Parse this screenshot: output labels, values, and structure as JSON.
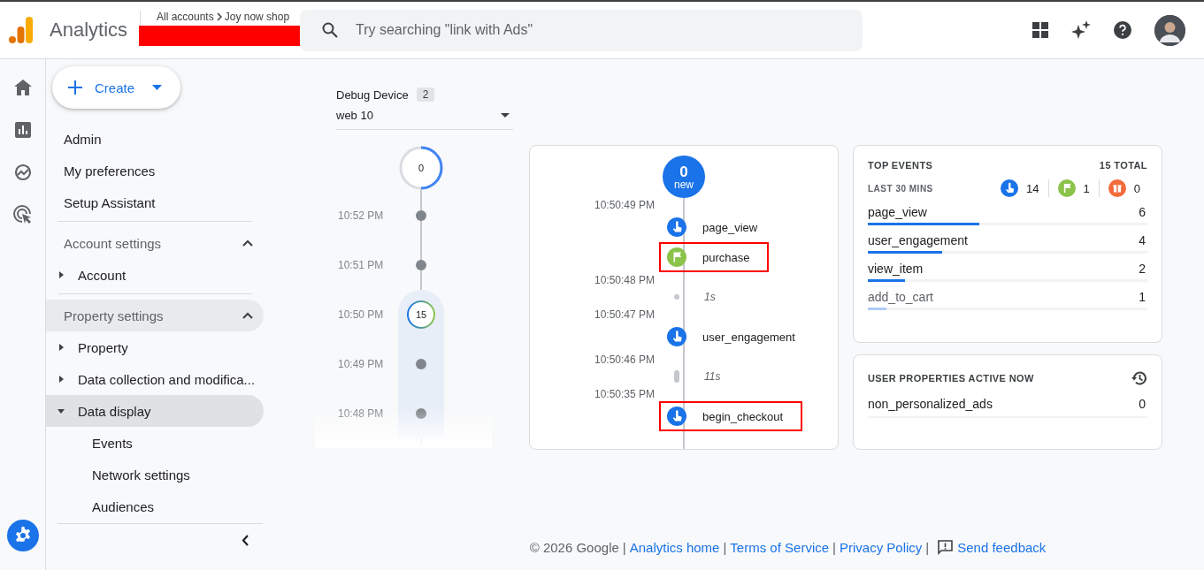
{
  "header": {
    "product": "Analytics",
    "breadcrumb": [
      "All accounts",
      "Joy now shop"
    ],
    "redacted": true,
    "search": {
      "placeholder": "Try searching \"link with Ads\""
    }
  },
  "rail": [
    {
      "kind": "home",
      "selected": false
    },
    {
      "kind": "reports",
      "selected": false
    },
    {
      "kind": "explore",
      "selected": false
    },
    {
      "kind": "advertising",
      "selected": false
    },
    {
      "kind": "settings",
      "selected": true
    }
  ],
  "nav": {
    "create": "Create",
    "items": [
      {
        "kind": "link",
        "label": "Admin",
        "selected": false,
        "hovered": false
      },
      {
        "kind": "link",
        "label": "My preferences",
        "selected": false,
        "hovered": false
      },
      {
        "kind": "link",
        "label": "Setup Assistant",
        "selected": false,
        "hovered": false
      },
      {
        "kind": "section",
        "label": "Account settings",
        "expanded": true,
        "selected": false,
        "hovered": false
      },
      {
        "kind": "parent",
        "label": "Account",
        "expanded": false,
        "selected": false,
        "hovered": false
      },
      {
        "kind": "section",
        "label": "Property settings",
        "expanded": true,
        "selected": false,
        "hovered": true
      },
      {
        "kind": "parent",
        "label": "Property",
        "expanded": false,
        "selected": false,
        "hovered": false
      },
      {
        "kind": "parent",
        "label": "Data collection and modifica...",
        "expanded": false,
        "selected": false,
        "hovered": false
      },
      {
        "kind": "parent",
        "label": "Data display",
        "expanded": true,
        "selected": true,
        "hovered": false
      },
      {
        "kind": "child",
        "label": "Events",
        "selected": false,
        "hovered": false
      },
      {
        "kind": "child",
        "label": "Network settings",
        "selected": false,
        "hovered": false
      },
      {
        "kind": "child",
        "label": "Audiences",
        "selected": false,
        "hovered": false
      }
    ]
  },
  "debug": {
    "label": "Debug Device",
    "count": "2",
    "value": "web 10"
  },
  "timeline": {
    "top_count": "0",
    "level": 0.5,
    "minutes": [
      {
        "time": "10:52 PM",
        "selected": false
      },
      {
        "time": "10:51 PM",
        "selected": false
      },
      {
        "time": "10:50 PM",
        "selected": true,
        "count": "15"
      },
      {
        "time": "10:49 PM",
        "selected": false
      },
      {
        "time": "10:48 PM",
        "selected": false
      }
    ]
  },
  "stream": {
    "new_count": "0",
    "new_label": "new",
    "rows": [
      {
        "kind": "time",
        "label": "10:50:49 PM"
      },
      {
        "kind": "click",
        "name": "page_view",
        "highlighted": false
      },
      {
        "kind": "flag",
        "name": "purchase",
        "highlighted": true
      },
      {
        "kind": "time",
        "label": "10:50:48 PM"
      },
      {
        "kind": "short_gap",
        "label": "1s"
      },
      {
        "kind": "time",
        "label": "10:50:47 PM"
      },
      {
        "kind": "click",
        "name": "user_engagement",
        "highlighted": false
      },
      {
        "kind": "time",
        "label": "10:50:46 PM"
      },
      {
        "kind": "long_gap",
        "label": "11s"
      },
      {
        "kind": "time",
        "label": "10:50:35 PM"
      },
      {
        "kind": "click",
        "name": "begin_checkout",
        "highlighted": true
      }
    ]
  },
  "top_events": {
    "title": "TOP EVENTS",
    "total": "15 TOTAL",
    "period": "LAST 30 MINS",
    "counters": [
      {
        "kind": "click",
        "count": "14"
      },
      {
        "kind": "flag",
        "count": "1"
      },
      {
        "kind": "error",
        "count": "0"
      }
    ],
    "rows": [
      {
        "name": "page_view",
        "count": "6",
        "level": 0.4,
        "muted": false
      },
      {
        "name": "user_engagement",
        "count": "4",
        "level": 0.267,
        "muted": false
      },
      {
        "name": "view_item",
        "count": "2",
        "level": 0.133,
        "muted": false
      },
      {
        "name": "add_to_cart",
        "count": "1",
        "level": 0.067,
        "muted": true
      }
    ]
  },
  "user_properties": {
    "title": "USER PROPERTIES ACTIVE NOW",
    "rows": [
      {
        "name": "non_personalized_ads",
        "value": "0"
      }
    ]
  },
  "footer": [
    {
      "kind": "text",
      "label": "© 2026 Google"
    },
    {
      "kind": "sep",
      "label": "|"
    },
    {
      "kind": "link",
      "label": "Analytics home"
    },
    {
      "kind": "sep",
      "label": "|"
    },
    {
      "kind": "link",
      "label": "Terms of Service"
    },
    {
      "kind": "sep",
      "label": "|"
    },
    {
      "kind": "link",
      "label": "Privacy Policy"
    },
    {
      "kind": "sep",
      "label": "|"
    },
    {
      "kind": "feedback",
      "label": "Send feedback"
    }
  ]
}
